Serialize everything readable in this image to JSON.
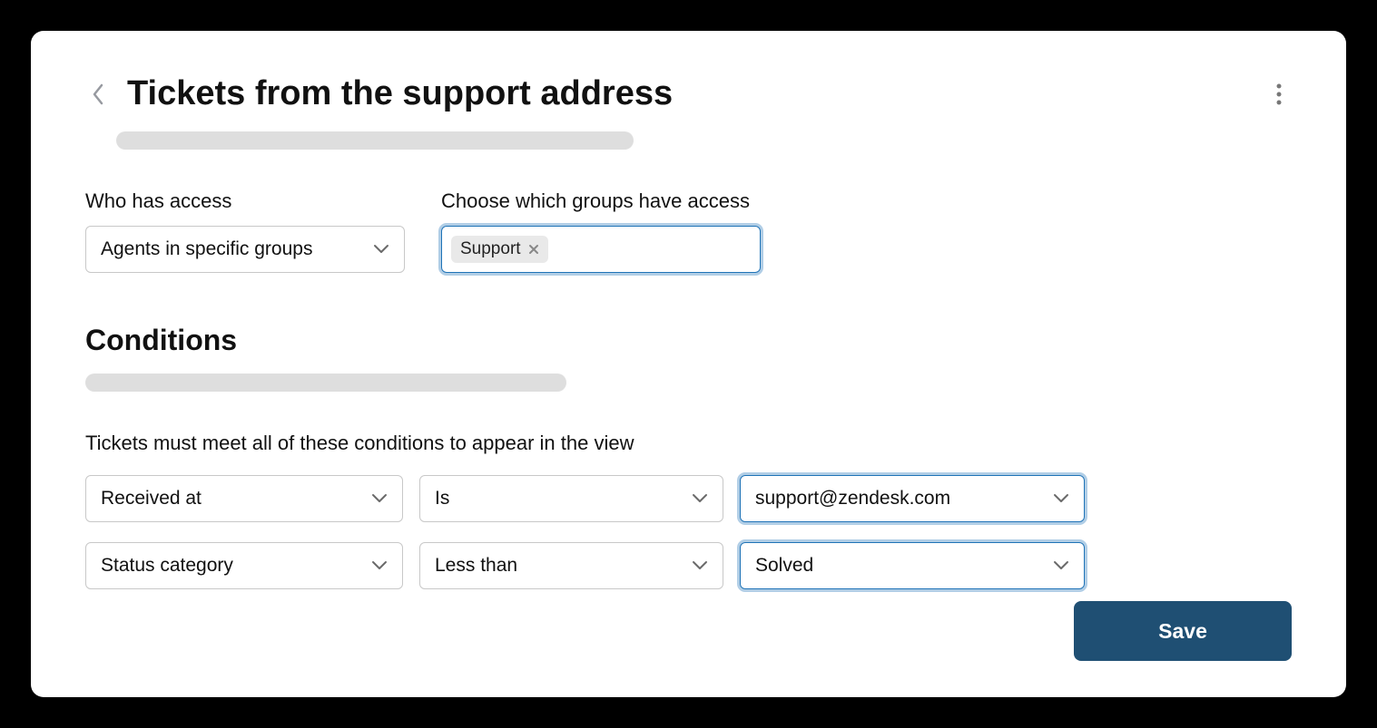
{
  "header": {
    "title": "Tickets from the support address"
  },
  "access": {
    "who_label": "Who has access",
    "who_value": "Agents in specific groups",
    "groups_label": "Choose which groups have access",
    "group_chip": "Support"
  },
  "conditions": {
    "heading": "Conditions",
    "description": "Tickets must meet all of these conditions to appear in the view",
    "rows": [
      {
        "field": "Received at",
        "operator": "Is",
        "value": "support@zendesk.com"
      },
      {
        "field": "Status category",
        "operator": "Less than",
        "value": "Solved"
      }
    ]
  },
  "actions": {
    "save": "Save"
  }
}
